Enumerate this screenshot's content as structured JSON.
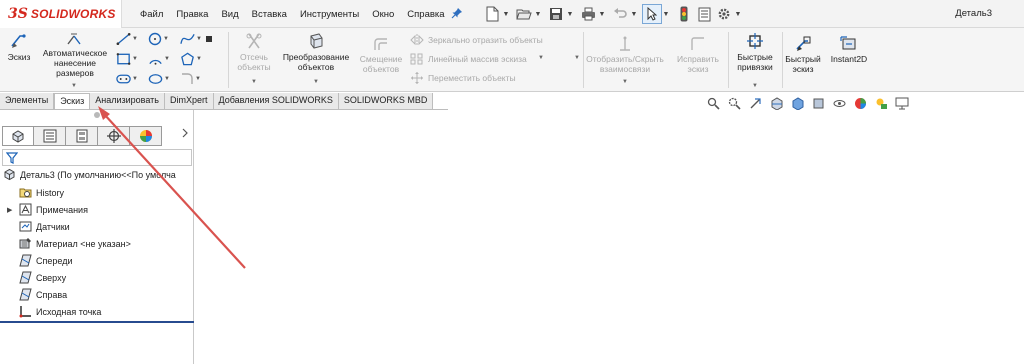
{
  "app": {
    "logo_mark": "3S",
    "logo_text": "SOLIDWORKS",
    "menu": [
      "Файл",
      "Правка",
      "Вид",
      "Вставка",
      "Инструменты",
      "Окно",
      "Справка"
    ],
    "document_title": "Деталь3",
    "brand_color": "#d4281e"
  },
  "ribbon": {
    "sketch": "Эскиз",
    "smart_dimension": "Автоматическое нанесение размеров",
    "trim": "Отсечь объекты",
    "convert": "Преобразование объектов",
    "offset": "Смещение объектов",
    "mirror": "Зеркально отразить объекты",
    "linear_pattern": "Линейный массив эскиза",
    "move": "Переместить объекты",
    "display_relations": "Отобразить/Скрыть взаимосвязи",
    "repair": "Исправить эскиз",
    "quick_snaps": "Быстрые привязки",
    "rapid_sketch": "Быстрый эскиз",
    "instant2d": "Instant2D"
  },
  "tabs": [
    {
      "label": "Элементы",
      "active": false
    },
    {
      "label": "Эскиз",
      "active": true
    },
    {
      "label": "Анализировать",
      "active": false
    },
    {
      "label": "DimXpert",
      "active": false
    },
    {
      "label": "Добавления SOLIDWORKS",
      "active": false
    },
    {
      "label": "SOLIDWORKS MBD",
      "active": false
    }
  ],
  "tree": {
    "root": "Деталь3  (По умолчанию<<По умолча",
    "items": [
      {
        "label": "History",
        "icon": "history-folder-icon",
        "expandable": false
      },
      {
        "label": "Примечания",
        "icon": "annotations-icon",
        "expandable": true
      },
      {
        "label": "Датчики",
        "icon": "sensors-icon",
        "expandable": false
      },
      {
        "label": "Материал <не указан>",
        "icon": "material-icon",
        "expandable": false
      },
      {
        "label": "Спереди",
        "icon": "plane-icon",
        "expandable": false
      },
      {
        "label": "Сверху",
        "icon": "plane-icon",
        "expandable": false
      },
      {
        "label": "Справа",
        "icon": "plane-icon",
        "expandable": false
      },
      {
        "label": "Исходная точка",
        "icon": "origin-icon",
        "expandable": false
      }
    ]
  },
  "annotation": {
    "color": "#d9534f"
  }
}
